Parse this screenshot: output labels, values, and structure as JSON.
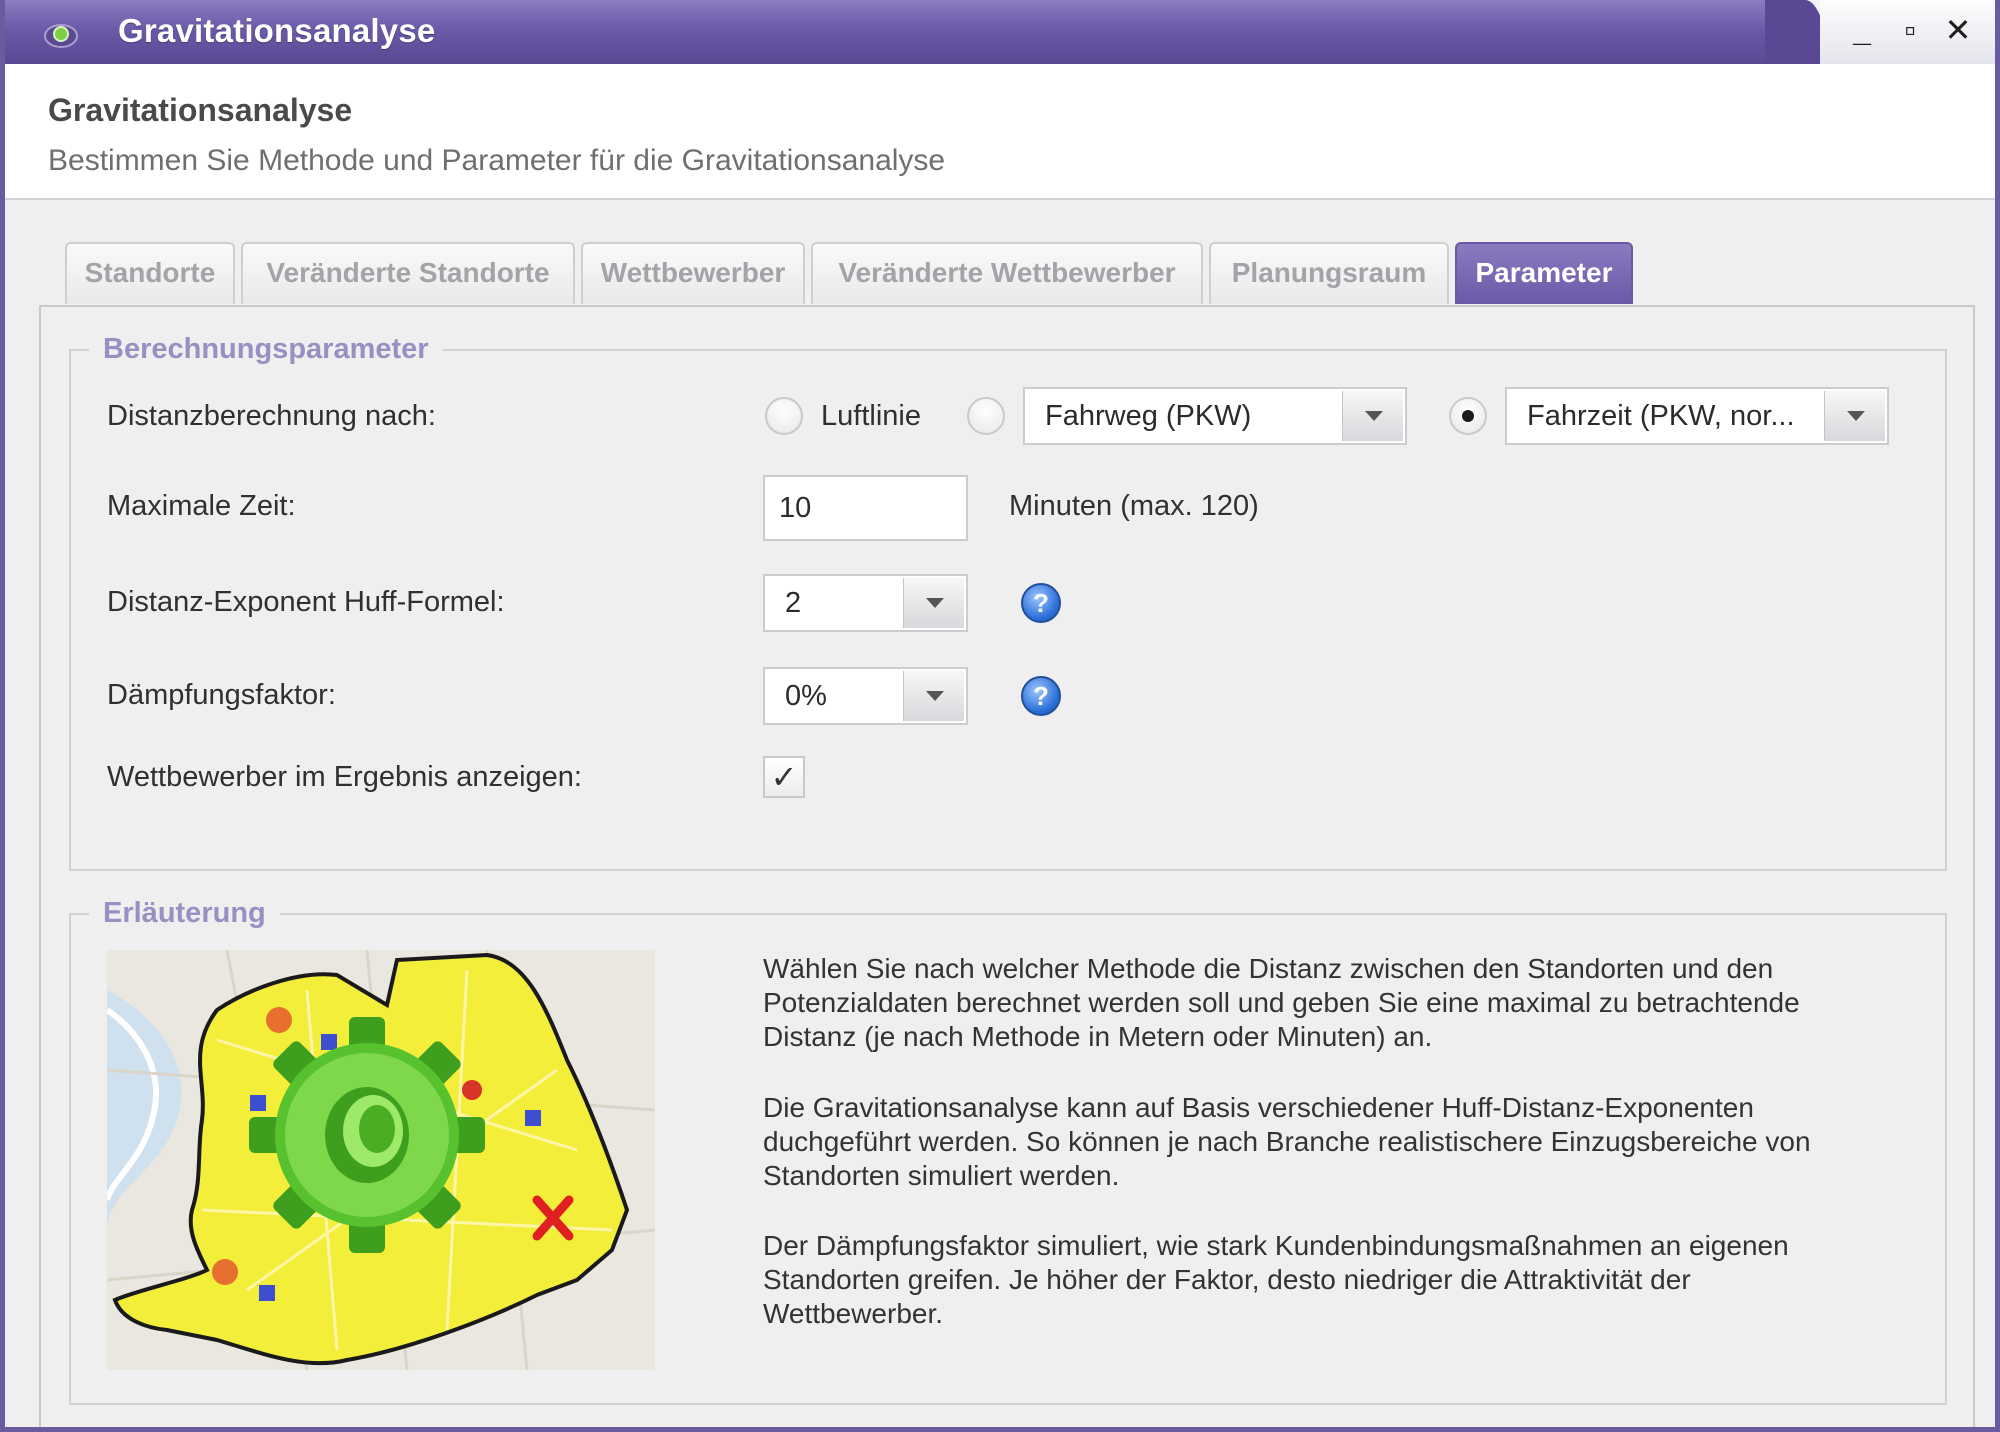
{
  "window": {
    "title": "Gravitationsanalyse",
    "controls": {
      "minimize": "_",
      "maximize": "▫",
      "close": "✕"
    }
  },
  "header": {
    "title": "Gravitationsanalyse",
    "subtitle": "Bestimmen Sie Methode und Parameter für die Gravitationsanalyse"
  },
  "tabs": [
    {
      "label": "Standorte",
      "active": false
    },
    {
      "label": "Veränderte Standorte",
      "active": false
    },
    {
      "label": "Wettbewerber",
      "active": false
    },
    {
      "label": "Veränderte Wettbewerber",
      "active": false
    },
    {
      "label": "Planungsraum",
      "active": false
    },
    {
      "label": "Parameter",
      "active": true
    }
  ],
  "params": {
    "legend": "Berechnungsparameter",
    "distance": {
      "label": "Distanzberechnung nach:",
      "option_air": "Luftlinie",
      "option_route": "Fahrweg (PKW)",
      "option_time": "Fahrzeit (PKW, nor...",
      "selected": "time"
    },
    "max_time": {
      "label": "Maximale Zeit:",
      "value": "10",
      "unit": "Minuten (max. 120)"
    },
    "huff_exponent": {
      "label": "Distanz-Exponent Huff-Formel:",
      "value": "2",
      "help": "?"
    },
    "damping": {
      "label": "Dämpfungsfaktor:",
      "value": "0%",
      "help": "?"
    },
    "show_competitors": {
      "label": "Wettbewerber im Ergebnis anzeigen:",
      "checked": true,
      "check_glyph": "✓"
    }
  },
  "explanation": {
    "legend": "Erläuterung",
    "lines": [
      "Wählen Sie nach welcher Methode die Distanz zwischen den Standorten und den",
      "Potenzialdaten berechnet werden soll und geben Sie eine maximal zu betrachtende",
      "Distanz (je nach Methode in Metern oder Minuten) an.",
      "Die Gravitationsanalyse kann auf Basis verschiedener Huff-Distanz-Exponenten",
      "duchgeführt werden. So können je nach Branche realistischere Einzugsbereiche von",
      "Standorten simuliert werden.",
      "Der Dämpfungsfaktor simuliert, wie stark Kundenbindungsmaßnahmen an eigenen",
      "Standorten greifen. Je höher der Faktor, desto niedriger die Attraktivität der",
      "Wettbewerber."
    ]
  },
  "colors": {
    "accent": "#6b5aa8",
    "legend": "#9a8fc2",
    "map_area": "#f2ee3a",
    "gear": "#4fb82c"
  },
  "icons": [
    "app-icon",
    "question-icon",
    "checkmark-icon",
    "chevron-down-icon",
    "gear-icon",
    "map-illustration"
  ]
}
